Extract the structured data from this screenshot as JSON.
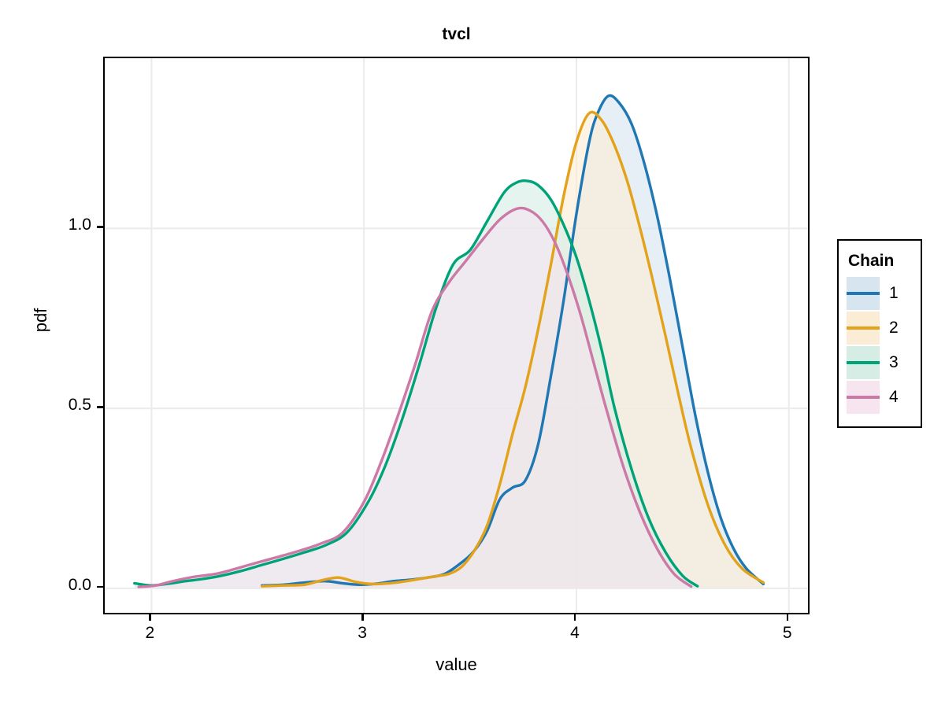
{
  "figure": {
    "title": "tvcl",
    "background": "#ffffff",
    "panel_border": "#000000",
    "grid_color": "#ebebeb"
  },
  "legend": {
    "title": "Chain",
    "position": "right",
    "entries": [
      {
        "label": "1",
        "color": "#1F78B4",
        "fill": "#D6E5F0"
      },
      {
        "label": "2",
        "color": "#E3A21A",
        "fill": "#FBEDD5"
      },
      {
        "label": "3",
        "color": "#00A378",
        "fill": "#D5EDE5"
      },
      {
        "label": "4",
        "color": "#CC79A7",
        "fill": "#F6E4EF"
      }
    ]
  },
  "chart_data": {
    "type": "area",
    "title": "tvcl",
    "xlabel": "value",
    "ylabel": "pdf",
    "xlim": [
      1.78,
      5.09
    ],
    "ylim": [
      -0.068,
      1.473
    ],
    "xticks": [
      2,
      3,
      4,
      5
    ],
    "xtick_labels": [
      "2",
      "3",
      "4",
      "5"
    ],
    "yticks": [
      0.0,
      0.5,
      1.0
    ],
    "ytick_labels": [
      "0.0",
      "0.5",
      "1.0"
    ],
    "grid": true,
    "legend_title": "Chain",
    "series": [
      {
        "name": "1",
        "color": "#1F78B4",
        "fill": "#D6E5F0",
        "x": [
          2.52,
          2.62,
          2.72,
          2.82,
          2.9,
          2.98,
          3.06,
          3.14,
          3.22,
          3.3,
          3.38,
          3.46,
          3.52,
          3.58,
          3.64,
          3.7,
          3.76,
          3.82,
          3.88,
          3.94,
          4.0,
          4.06,
          4.1,
          4.15,
          4.2,
          4.26,
          4.32,
          4.38,
          4.44,
          4.5,
          4.56,
          4.62,
          4.68,
          4.74,
          4.8,
          4.88
        ],
        "y": [
          0.008,
          0.01,
          0.016,
          0.02,
          0.014,
          0.01,
          0.013,
          0.02,
          0.024,
          0.03,
          0.04,
          0.072,
          0.105,
          0.16,
          0.248,
          0.28,
          0.3,
          0.4,
          0.59,
          0.8,
          1.04,
          1.24,
          1.32,
          1.368,
          1.35,
          1.29,
          1.18,
          1.035,
          0.86,
          0.67,
          0.48,
          0.32,
          0.195,
          0.11,
          0.055,
          0.012
        ]
      },
      {
        "name": "2",
        "color": "#E3A21A",
        "fill": "#FBEDD5",
        "x": [
          2.52,
          2.62,
          2.72,
          2.8,
          2.88,
          2.96,
          3.04,
          3.12,
          3.2,
          3.28,
          3.34,
          3.4,
          3.46,
          3.52,
          3.58,
          3.64,
          3.7,
          3.76,
          3.82,
          3.88,
          3.94,
          4.0,
          4.06,
          4.12,
          4.18,
          4.24,
          4.3,
          4.36,
          4.42,
          4.48,
          4.54,
          4.62,
          4.7,
          4.78,
          4.88
        ],
        "y": [
          0.006,
          0.008,
          0.01,
          0.022,
          0.03,
          0.018,
          0.012,
          0.014,
          0.02,
          0.028,
          0.034,
          0.04,
          0.06,
          0.105,
          0.175,
          0.29,
          0.43,
          0.56,
          0.72,
          0.9,
          1.09,
          1.24,
          1.32,
          1.3,
          1.23,
          1.13,
          1.0,
          0.855,
          0.7,
          0.54,
          0.39,
          0.23,
          0.12,
          0.055,
          0.016
        ]
      },
      {
        "name": "3",
        "color": "#00A378",
        "fill": "#D5EDE5",
        "x": [
          1.92,
          2.0,
          2.08,
          2.16,
          2.24,
          2.32,
          2.42,
          2.52,
          2.62,
          2.72,
          2.82,
          2.92,
          3.02,
          3.1,
          3.18,
          3.26,
          3.34,
          3.42,
          3.5,
          3.58,
          3.66,
          3.72,
          3.77,
          3.82,
          3.88,
          3.94,
          4.0,
          4.06,
          4.12,
          4.18,
          4.26,
          4.34,
          4.42,
          4.5,
          4.57
        ],
        "y": [
          0.014,
          0.008,
          0.013,
          0.02,
          0.026,
          0.034,
          0.048,
          0.065,
          0.082,
          0.1,
          0.12,
          0.155,
          0.24,
          0.34,
          0.47,
          0.62,
          0.78,
          0.9,
          0.94,
          1.02,
          1.1,
          1.128,
          1.132,
          1.12,
          1.08,
          1.01,
          0.92,
          0.8,
          0.66,
          0.5,
          0.33,
          0.195,
          0.1,
          0.035,
          0.006
        ]
      },
      {
        "name": "4",
        "color": "#CC79A7",
        "fill": "#F6E4EF",
        "x": [
          1.94,
          2.02,
          2.1,
          2.2,
          2.3,
          2.4,
          2.5,
          2.6,
          2.7,
          2.8,
          2.9,
          3.0,
          3.08,
          3.16,
          3.24,
          3.32,
          3.4,
          3.48,
          3.56,
          3.64,
          3.72,
          3.78,
          3.84,
          3.9,
          3.96,
          4.02,
          4.08,
          4.14,
          4.22,
          4.3,
          4.38,
          4.46,
          4.54
        ],
        "y": [
          0.004,
          0.008,
          0.02,
          0.032,
          0.04,
          0.055,
          0.072,
          0.088,
          0.105,
          0.125,
          0.155,
          0.24,
          0.35,
          0.48,
          0.62,
          0.77,
          0.85,
          0.91,
          0.97,
          1.025,
          1.055,
          1.05,
          1.02,
          0.96,
          0.87,
          0.76,
          0.63,
          0.5,
          0.34,
          0.21,
          0.11,
          0.04,
          0.005
        ]
      }
    ]
  }
}
